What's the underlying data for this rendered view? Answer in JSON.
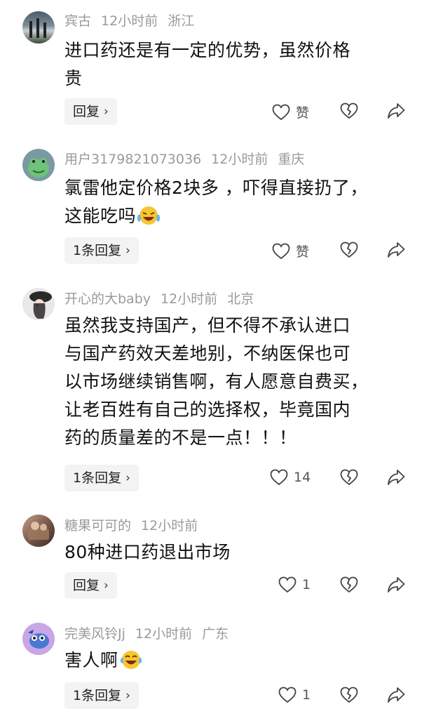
{
  "comments": [
    {
      "user": "宾古",
      "time": "12小时前",
      "location": "浙江",
      "text_lines": [
        "进口药还是有一定的优势，虽然价格",
        "贵"
      ],
      "reply_label": "回复",
      "like_label": "赞",
      "avatar": "landscape-avatar"
    },
    {
      "user": "用户3179821073036",
      "time": "12小时前",
      "location": "重庆",
      "text_lines": [
        "氯雷他定价格2块多 ，吓得直接扔了，",
        "这能吃吗"
      ],
      "emoji": "crying-laughing-emoji",
      "reply_label": "1条回复",
      "like_label": "赞",
      "avatar": "frog-avatar"
    },
    {
      "user": "开心的大baby",
      "time": "12小时前",
      "location": "北京",
      "text_lines": [
        "虽然我支持国产，但不得不承认进口",
        "与国产药效天差地别，不纳医保也可",
        "以市场继续销售啊，有人愿意自费买，",
        "让老百姓有自己的选择权，毕竟国内",
        "药的质量差的不是一点！！！"
      ],
      "reply_label": "1条回复",
      "like_label": "14",
      "avatar": "woman-hat-avatar"
    },
    {
      "user": "糖果可可的",
      "time": "12小时前",
      "location": "",
      "text_lines": [
        "80种进口药退出市场"
      ],
      "reply_label": "回复",
      "like_label": "1",
      "avatar": "photo-avatar"
    },
    {
      "user": "完美风铃Jj",
      "time": "12小时前",
      "location": "广东",
      "text_lines": [
        "害人啊"
      ],
      "emoji": "laughing-tears-emoji",
      "reply_label": "1条回复",
      "like_label": "1",
      "avatar": "cartoon-avatar"
    }
  ],
  "icons": {
    "like": "heart-outline-icon",
    "dislike": "broken-heart-icon",
    "share": "share-arrow-icon",
    "chevron": "chevron-right-icon"
  }
}
